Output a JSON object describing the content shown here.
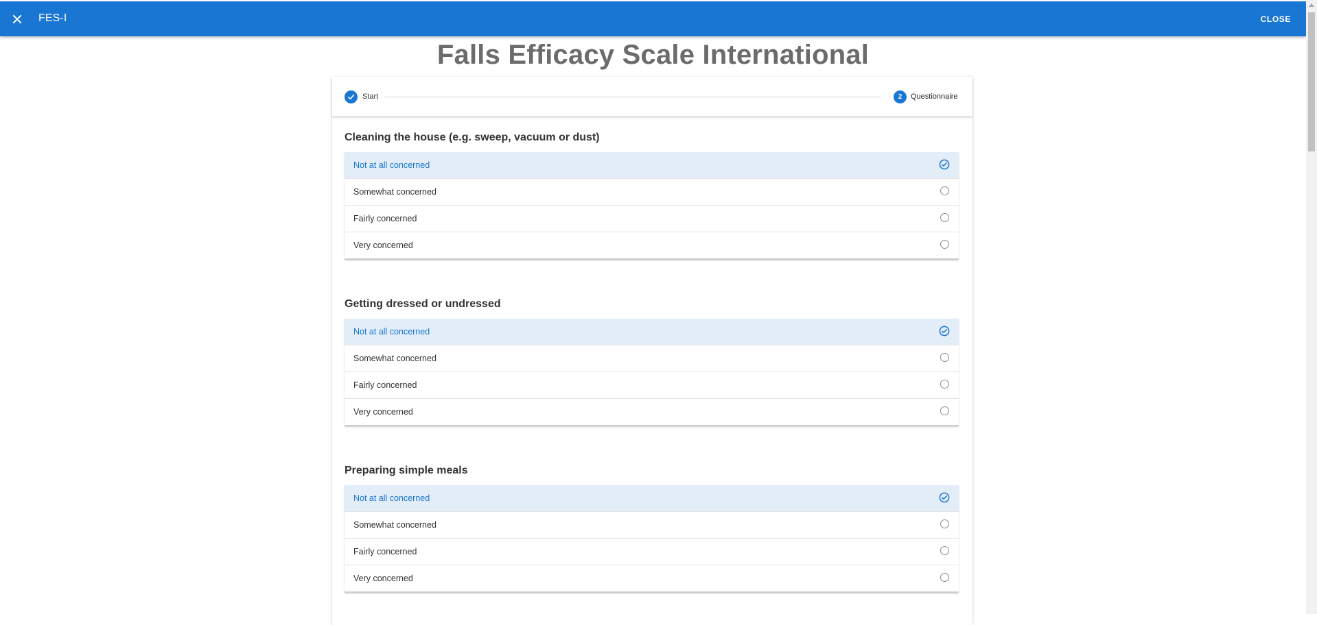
{
  "appbar": {
    "title": "FES-I",
    "close_label": "CLOSE",
    "close_icon": "close-icon",
    "color": "#1976d2"
  },
  "page_title": "Falls Efficacy Scale International",
  "stepper": {
    "steps": [
      {
        "label": "Start",
        "state": "completed",
        "icon": "check-icon"
      },
      {
        "label": "Questionnaire",
        "state": "active",
        "number": "2"
      }
    ]
  },
  "questions": [
    {
      "title": "Cleaning the house (e.g. sweep, vacuum or dust)",
      "selected": 0,
      "options": [
        "Not at all concerned",
        "Somewhat concerned",
        "Fairly concerned",
        "Very concerned"
      ]
    },
    {
      "title": "Getting dressed or undressed",
      "selected": 0,
      "options": [
        "Not at all concerned",
        "Somewhat concerned",
        "Fairly concerned",
        "Very concerned"
      ]
    },
    {
      "title": "Preparing simple meals",
      "selected": 0,
      "options": [
        "Not at all concerned",
        "Somewhat concerned",
        "Fairly concerned",
        "Very concerned"
      ]
    }
  ],
  "colors": {
    "accent": "#1976d2",
    "selected_row": "#e3edf8",
    "title_gray": "#6b6b6b"
  }
}
